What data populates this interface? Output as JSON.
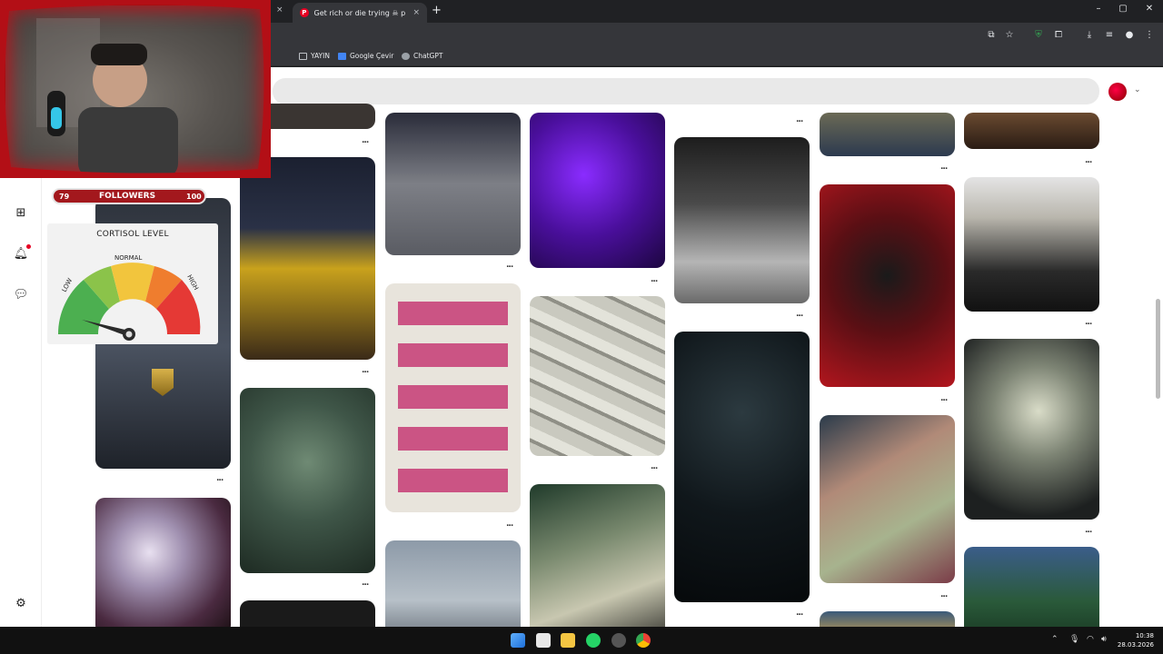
{
  "browser": {
    "tab_active": {
      "title": "Get rich or die trying ☠ panosu",
      "close": "×"
    },
    "tab_prev_close": "×",
    "new_tab": "+",
    "window_controls": {
      "minimize": "–",
      "maximize": "▢",
      "close": "✕"
    }
  },
  "bookmarks": [
    {
      "label": "YAYIN",
      "icon": "folder-icon"
    },
    {
      "label": "Google Çevir",
      "icon": "google-translate-icon"
    },
    {
      "label": "ChatGPT",
      "icon": "chatgpt-icon"
    }
  ],
  "overlay": {
    "followers": {
      "current": "79",
      "label": "FOLLOWERS",
      "goal": "100",
      "progress": 0.79
    },
    "cortisol": {
      "title": "CORTISOL LEVEL",
      "low": "LOW",
      "normal": "NORMAL",
      "high": "HIGH",
      "level": 0.08
    }
  },
  "pins": {
    "more_label": "..."
  },
  "taskbar": {
    "time": "10:38",
    "date": "28.03.2026"
  },
  "colors": {
    "accent": "#e60023",
    "gauge_low": "#4caf50",
    "gauge_mid": "#f2c53d",
    "gauge_high": "#e53935"
  }
}
